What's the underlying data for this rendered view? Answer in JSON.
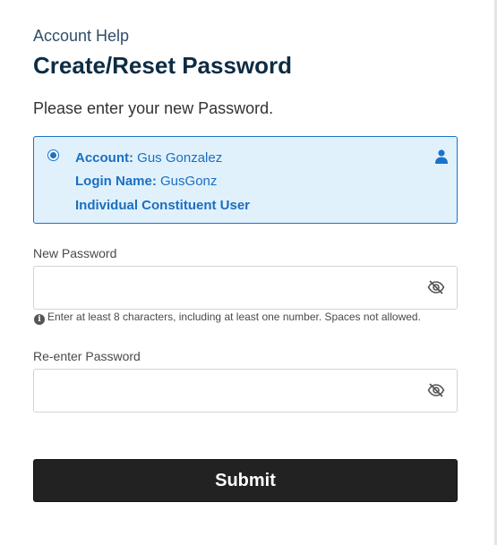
{
  "header": {
    "eyebrow": "Account Help",
    "title": "Create/Reset Password",
    "intro": "Please enter your new Password."
  },
  "account_card": {
    "selected": true,
    "account_label": "Account:",
    "account_value": "Gus Gonzalez",
    "login_label": "Login Name:",
    "login_value": "GusGonz",
    "user_type": "Individual Constituent User",
    "icon": "user-icon"
  },
  "new_password": {
    "label": "New Password",
    "value": "",
    "placeholder": "",
    "toggle_icon": "eye-slash-icon",
    "hint": "Enter at least 8 characters, including at least one number. Spaces not allowed.",
    "hint_icon": "info-icon"
  },
  "reenter_password": {
    "label": "Re-enter Password",
    "value": "",
    "placeholder": "",
    "toggle_icon": "eye-slash-icon"
  },
  "submit": {
    "label": "Submit"
  },
  "colors": {
    "accent": "#1a73c9",
    "card_bg": "#e1f1fc",
    "title": "#0d2c44",
    "button_bg": "#222222"
  }
}
